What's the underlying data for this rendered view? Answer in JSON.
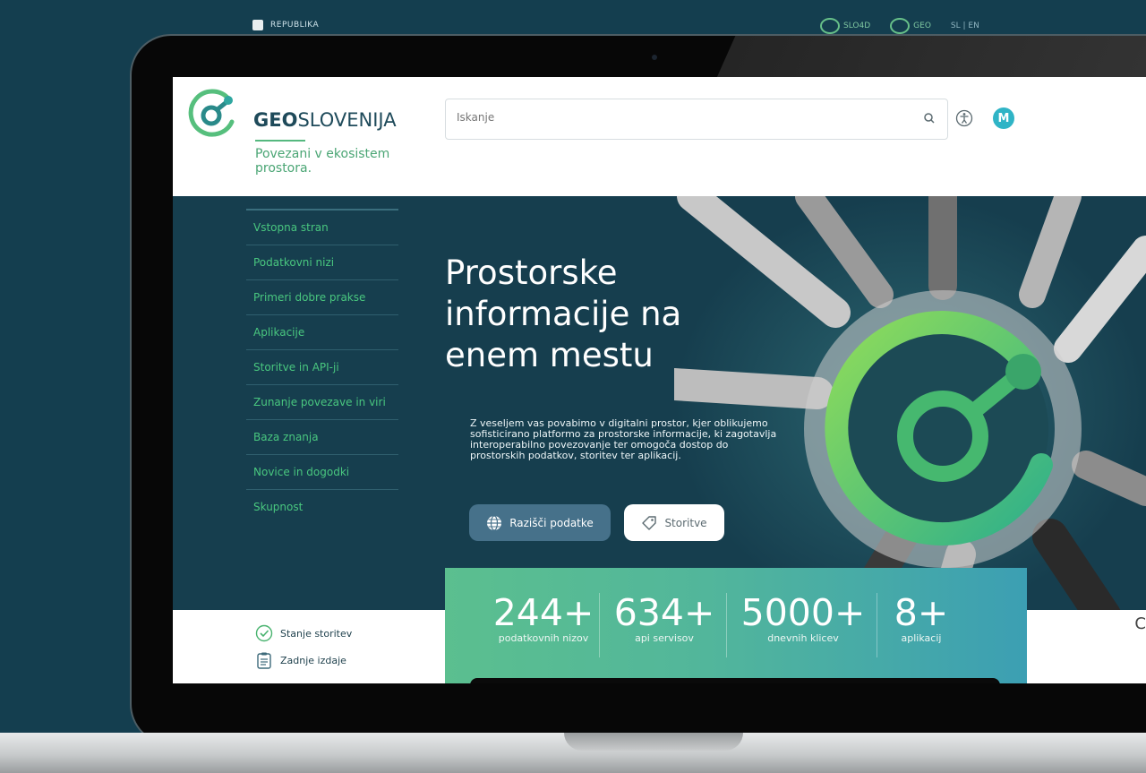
{
  "top_strip": {
    "gov_label": "REPUBLIKA",
    "partner1": "SLO4D",
    "partner2": "GEO",
    "lang": "SL | EN"
  },
  "header": {
    "logo_bold": "GEO",
    "logo_rest": "SLOVENIJA",
    "tagline": "Povezani v ekosistem prostora.",
    "search_placeholder": "Iskanje",
    "avatar_initial": "M"
  },
  "sidebar": {
    "items": [
      {
        "label": "Vstopna stran"
      },
      {
        "label": "Podatkovni nizi"
      },
      {
        "label": "Primeri dobre prakse"
      },
      {
        "label": "Aplikacije"
      },
      {
        "label": "Storitve in API-ji"
      },
      {
        "label": "Zunanje povezave in viri"
      },
      {
        "label": "Baza znanja"
      },
      {
        "label": "Novice in dogodki"
      },
      {
        "label": "Skupnost"
      }
    ]
  },
  "hero": {
    "title": "Prostorske informacije na enem mestu",
    "description": "Z veseljem vas povabimo v digitalni prostor, kjer oblikujemo sofisticirano platformo za prostorske informacije, ki zagotavlja interoperabilno povezovanje ter omogoča dostop do prostorskih podatkov, storitev ter aplikacij.",
    "btn_explore": "Razišči podatke",
    "btn_services": "Storitve"
  },
  "status": {
    "service_state": "Stanje storitev",
    "last_releases": "Zadnje izdaje"
  },
  "stats": [
    {
      "num": "244+",
      "label": "podatkovnih nizov"
    },
    {
      "num": "634+",
      "label": "api servisov"
    },
    {
      "num": "5000+",
      "label": "dnevnih klicev"
    },
    {
      "num": "8+",
      "label": "aplikacij"
    }
  ],
  "partial_text": "C",
  "colors": {
    "brand_green": "#49c77f",
    "dark_teal": "#163e4e",
    "accent_cyan": "#2fb4c6"
  }
}
